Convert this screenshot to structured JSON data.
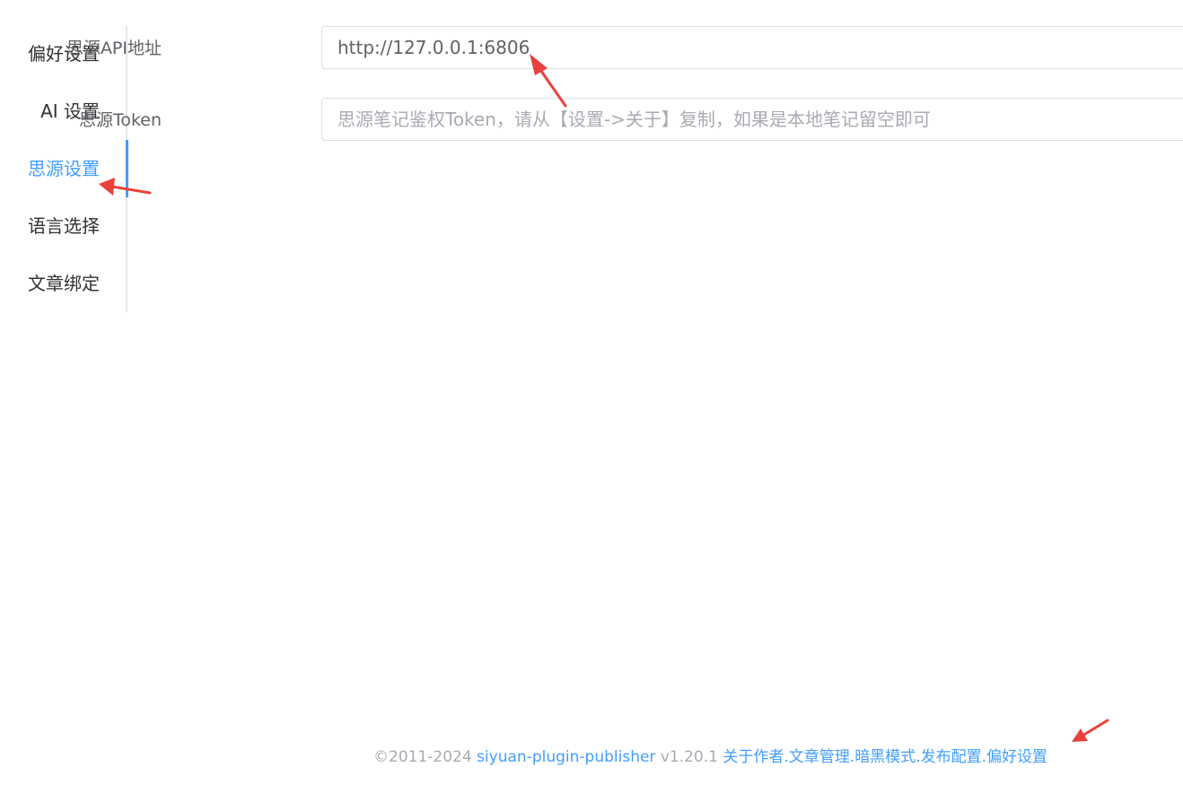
{
  "sidebar": {
    "tabs": [
      {
        "label": "偏好设置"
      },
      {
        "label": "AI 设置"
      },
      {
        "label": "思源设置"
      },
      {
        "label": "语言选择"
      },
      {
        "label": "文章绑定"
      }
    ],
    "active_tab": "思源设置"
  },
  "form": {
    "api_address": {
      "label": "思源API地址",
      "value": "http://127.0.0.1:6806"
    },
    "token": {
      "label": "思源Token",
      "value": "",
      "placeholder": "思源笔记鉴权Token，请从【设置->关于】复制，如果是本地笔记留空即可"
    }
  },
  "footer": {
    "copyright": "©2011-2024 ",
    "project_link": "siyuan-plugin-publisher",
    "version": " v1.20.1 ",
    "links": [
      "关于作者",
      "文章管理",
      "暗黑模式",
      "发布配置",
      "偏好设置"
    ],
    "separator": "."
  },
  "colors": {
    "accent": "#409eff",
    "annotation_arrow": "#e8413c",
    "text_primary": "#303133",
    "text_secondary": "#606266",
    "placeholder": "#a8abb2"
  }
}
